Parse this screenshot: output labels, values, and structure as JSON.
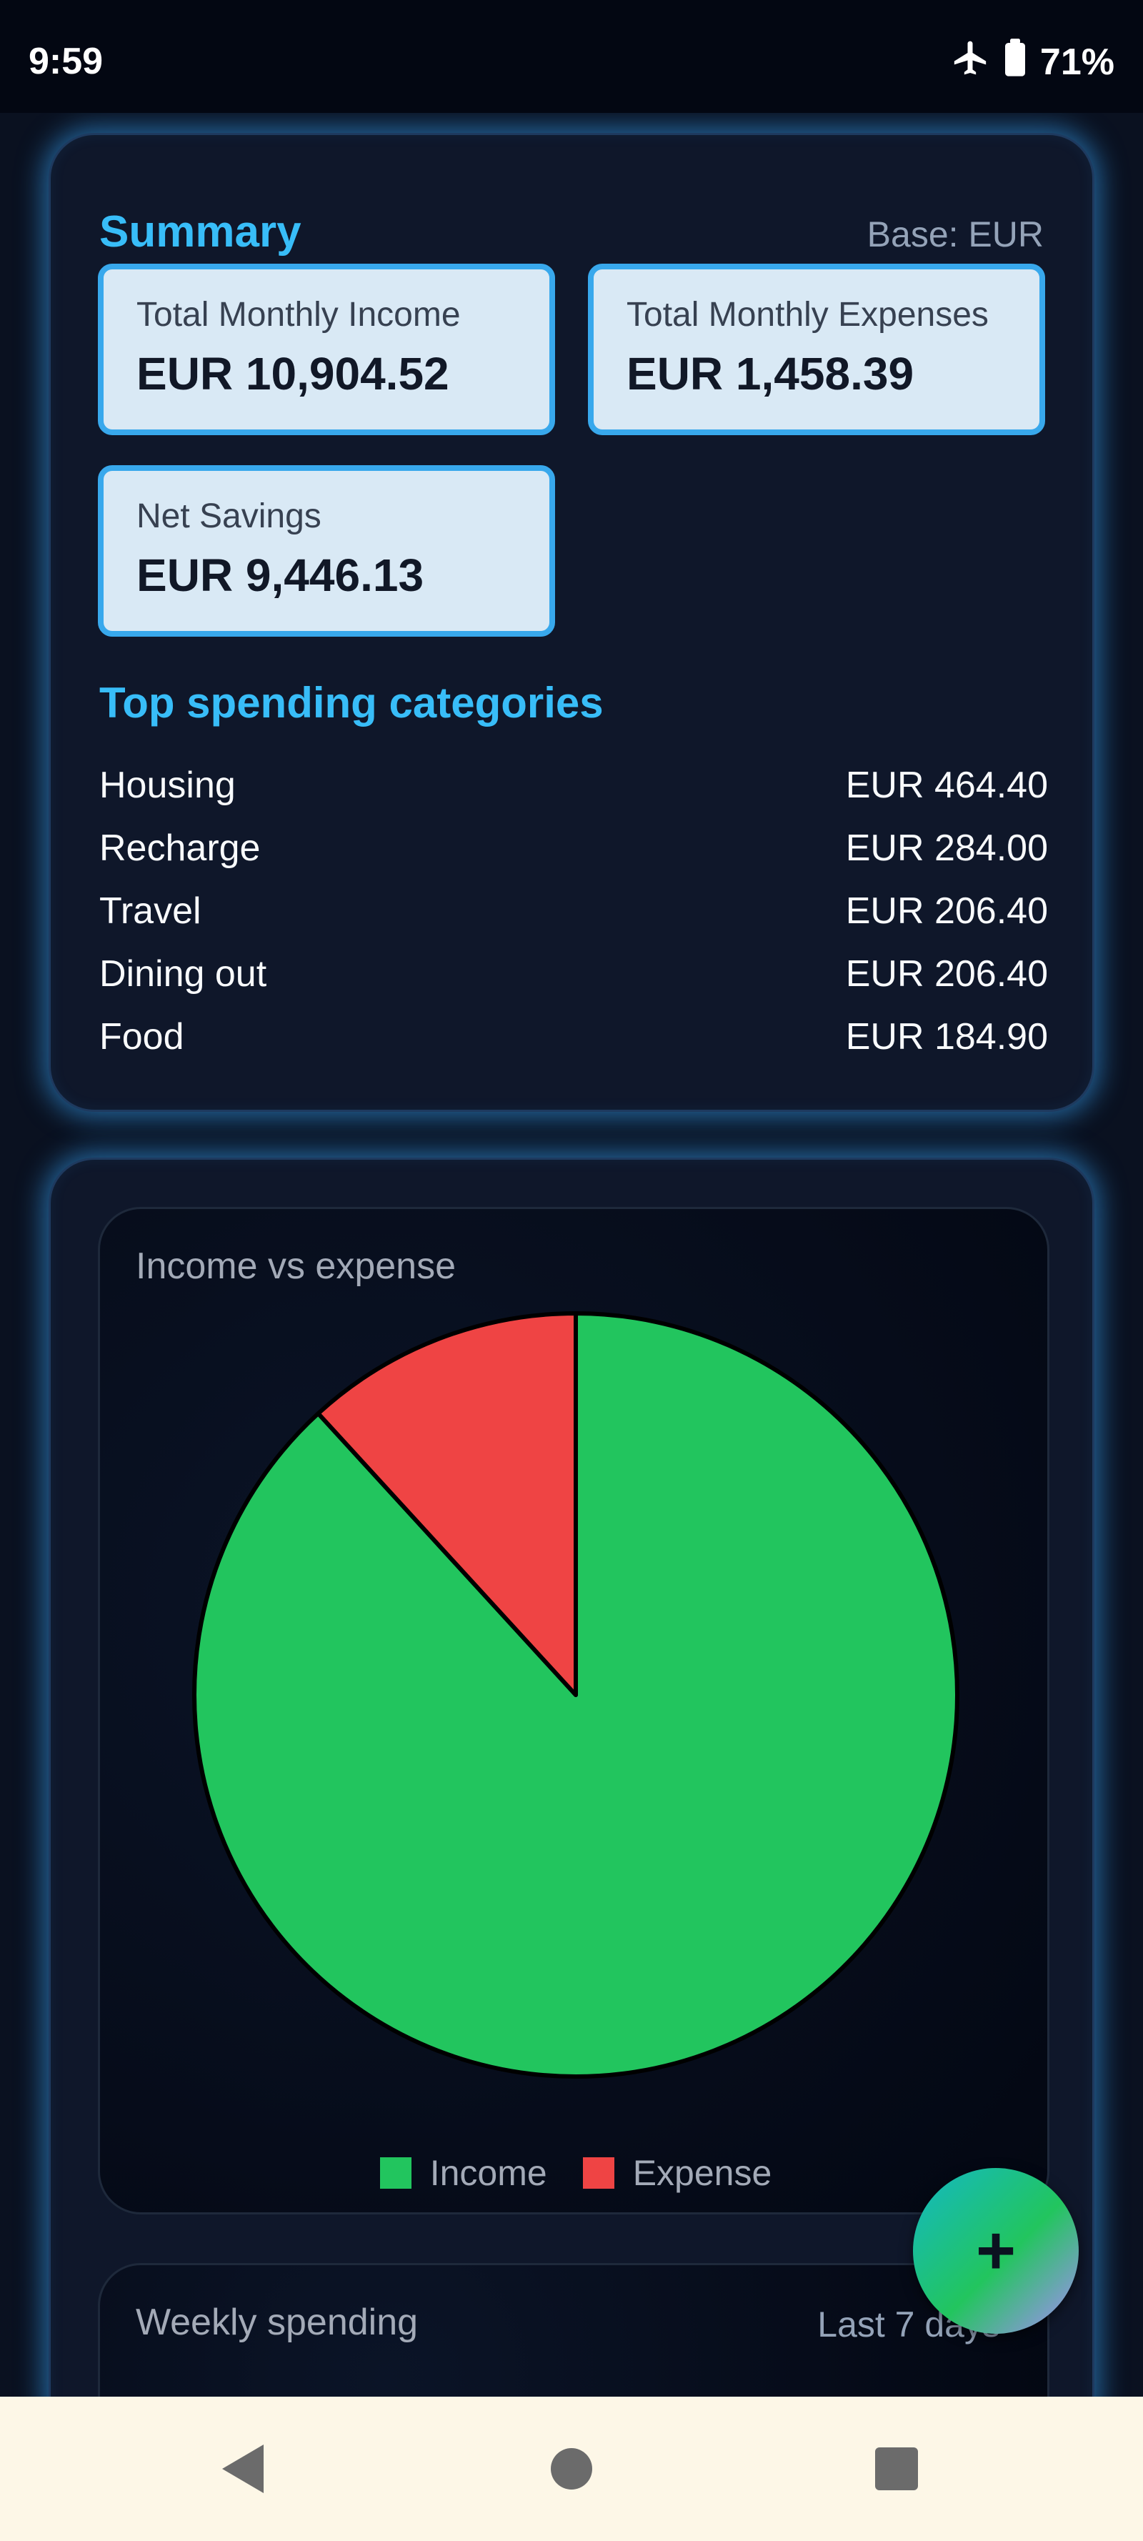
{
  "status_bar": {
    "time": "9:59",
    "battery": "71%"
  },
  "summary": {
    "title": "Summary",
    "base": "Base: EUR",
    "income": {
      "label": "Total Monthly Income",
      "value": "EUR 10,904.52"
    },
    "expenses": {
      "label": "Total Monthly Expenses",
      "value": "EUR 1,458.39"
    },
    "savings": {
      "label": "Net Savings",
      "value": "EUR 9,446.13"
    },
    "top_title": "Top spending categories",
    "categories": [
      {
        "name": "Housing",
        "amount": "EUR 464.40"
      },
      {
        "name": "Recharge",
        "amount": "EUR 284.00"
      },
      {
        "name": "Travel",
        "amount": "EUR 206.40"
      },
      {
        "name": "Dining out",
        "amount": "EUR 206.40"
      },
      {
        "name": "Food",
        "amount": "EUR 184.90"
      }
    ]
  },
  "pie_panel": {
    "title": "Income vs expense"
  },
  "weekly_panel": {
    "title": "Weekly spending",
    "range": "Last 7 days"
  },
  "fab": {
    "label": "+"
  },
  "chart_data": {
    "type": "pie",
    "title": "Income vs expense",
    "series": [
      {
        "name": "Income",
        "value": 10904.52,
        "color": "#22c55e"
      },
      {
        "name": "Expense",
        "value": 1458.39,
        "color": "#ef4444"
      }
    ],
    "legend_position": "bottom"
  },
  "colors": {
    "accent": "#38bdf8",
    "income": "#22c55e",
    "expense": "#ef4444",
    "card_bg": "#0f172a",
    "stat_box_bg": "#d9e9f5",
    "nav_bg": "#fdf7e7"
  },
  "icons": {
    "airplane": "airplane-mode-icon",
    "battery": "battery-icon",
    "back": "back-triangle-icon",
    "home": "home-circle-icon",
    "recents": "recents-square-icon",
    "add": "plus-icon"
  }
}
